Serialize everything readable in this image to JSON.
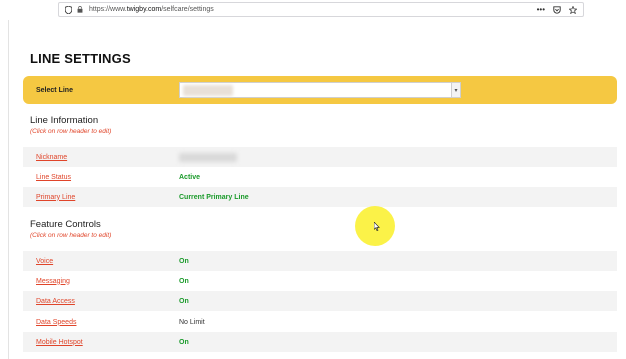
{
  "browser": {
    "url_prefix": "https://www.",
    "url_domain": "twigby.com",
    "url_path": "/selfcare/settings",
    "icons": [
      "shield-icon",
      "lock-icon",
      "more-icon",
      "pocket-icon",
      "star-icon"
    ]
  },
  "page": {
    "title": "LINE SETTINGS",
    "select_line": {
      "label": "Select Line",
      "value": ""
    },
    "line_information": {
      "heading": "Line Information",
      "hint": "(Click on row header to edit)",
      "rows": [
        {
          "label": "Nickname",
          "value": ""
        },
        {
          "label": "Line Status",
          "value": "Active"
        },
        {
          "label": "Primary Line",
          "value": "Current Primary Line"
        }
      ]
    },
    "feature_controls": {
      "heading": "Feature Controls",
      "hint": "(Click on row header to edit)",
      "rows": [
        {
          "label": "Voice",
          "value": "On"
        },
        {
          "label": "Messaging",
          "value": "On"
        },
        {
          "label": "Data Access",
          "value": "On"
        },
        {
          "label": "Data Speeds",
          "value": "No Limit"
        },
        {
          "label": "Mobile Hotspot",
          "value": "On"
        }
      ]
    }
  },
  "colors": {
    "accent_yellow": "#f5c842",
    "link_red": "#e0452a",
    "status_green": "#1a9a2a"
  }
}
